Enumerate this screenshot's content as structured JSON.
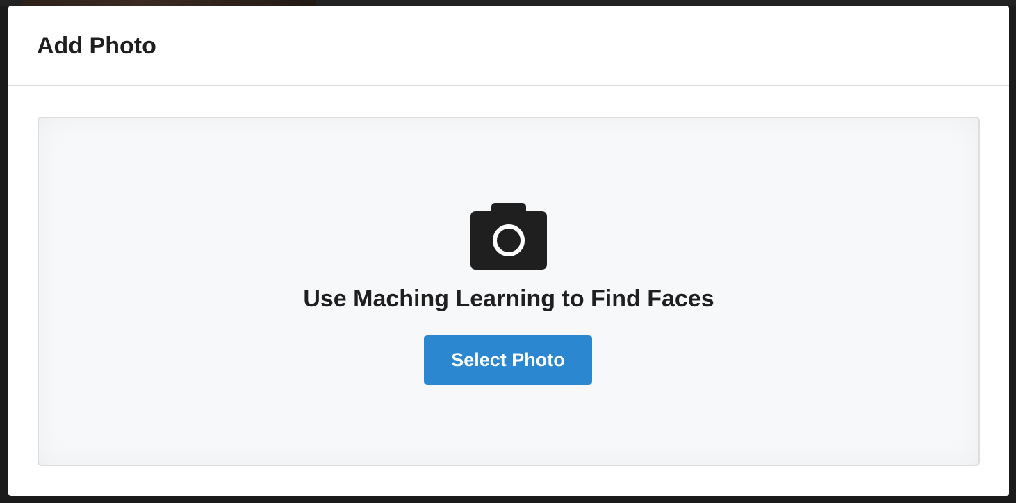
{
  "modal": {
    "title": "Add Photo"
  },
  "dropzone": {
    "icon": "camera-icon",
    "heading": "Use Maching Learning to Find Faces",
    "button_label": "Select Photo"
  },
  "colors": {
    "button_background": "#2a87d0",
    "button_text": "#ffffff",
    "dropzone_background": "#f7f8fa",
    "icon": "#1f1f1f",
    "text": "#1f1f1f"
  }
}
